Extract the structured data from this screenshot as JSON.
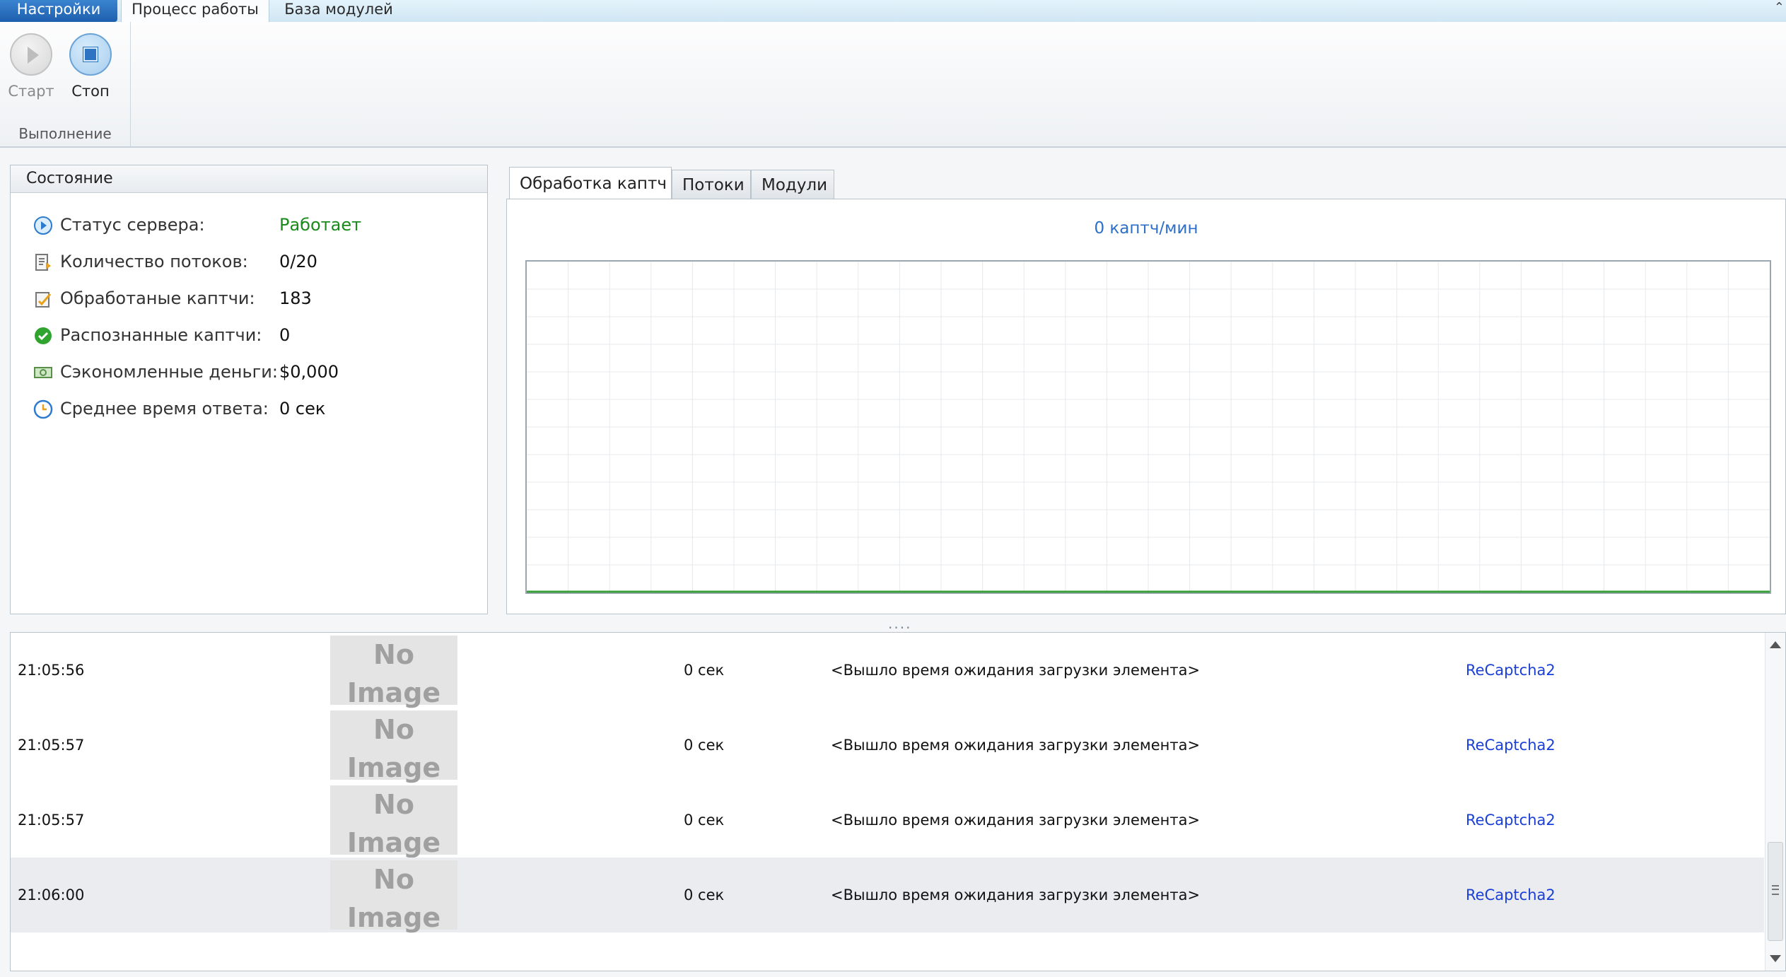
{
  "ribbon": {
    "tabs": [
      "Настройки",
      "Процесс работы",
      "База модулей"
    ],
    "start_label": "Старт",
    "stop_label": "Стоп",
    "group_label": "Выполнение"
  },
  "status": {
    "title": "Состояние",
    "rows": [
      {
        "label": "Статус сервера:",
        "value": "Работает",
        "icon": "server-status-icon",
        "value_color": "#1a8a1a"
      },
      {
        "label": "Количество потоков:",
        "value": "0/20",
        "icon": "threads-icon"
      },
      {
        "label": "Обработаные каптчи:",
        "value": "183",
        "icon": "processed-icon"
      },
      {
        "label": "Распознанные каптчи:",
        "value": "0",
        "icon": "recognized-check-icon"
      },
      {
        "label": "Сэкономленные деньги:",
        "value": "$0,000",
        "icon": "money-icon"
      },
      {
        "label": "Среднее время ответа:",
        "value": "0 сек",
        "icon": "clock-icon"
      }
    ]
  },
  "chart_tabs": [
    "Обработка каптч",
    "Потоки",
    "Модули"
  ],
  "chart_data": {
    "type": "line",
    "title": "0 каптч/мин",
    "series": [
      {
        "values": [
          0,
          0,
          0,
          0,
          0,
          0,
          0,
          0,
          0,
          0,
          0,
          0,
          0,
          0,
          0,
          0,
          0,
          0
        ]
      }
    ],
    "grid": true,
    "colors": {
      "line": "#3aa03a",
      "grid": "#e6e9ec"
    }
  },
  "splitter": "....",
  "log": {
    "no_image": [
      "No",
      "Image"
    ],
    "rows": [
      {
        "time": "21:05:56",
        "duration": "0 сек",
        "message": "<Вышло время ожидания загрузки элемента>",
        "module": "ReCaptcha2"
      },
      {
        "time": "21:05:57",
        "duration": "0 сек",
        "message": "<Вышло время ожидания загрузки элемента>",
        "module": "ReCaptcha2"
      },
      {
        "time": "21:05:57",
        "duration": "0 сек",
        "message": "<Вышло время ожидания загрузки элемента>",
        "module": "ReCaptcha2"
      },
      {
        "time": "21:06:00",
        "duration": "0 сек",
        "message": "<Вышло время ожидания загрузки элемента>",
        "module": "ReCaptcha2",
        "selected": true
      }
    ]
  }
}
